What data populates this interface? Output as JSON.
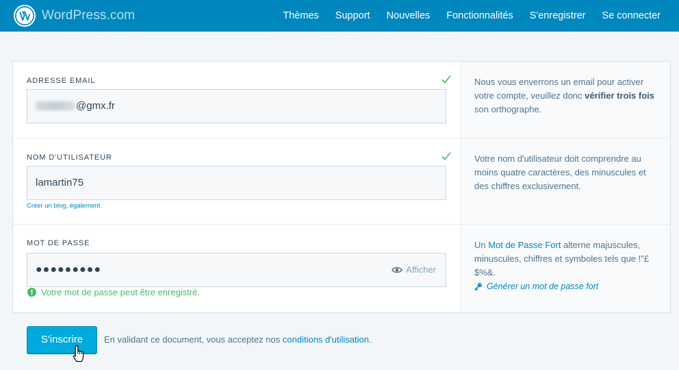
{
  "header": {
    "brand": "WordPress.com",
    "nav": [
      "Thèmes",
      "Support",
      "Nouvelles",
      "Fonctionnalités",
      "S'enregistrer",
      "Se connecter"
    ]
  },
  "email": {
    "label": "ADRESSE EMAIL",
    "value_visible": "@gmx.fr",
    "help_before": "Nous vous enverrons un email pour activer votre compte, veuillez donc ",
    "help_bold": "vérifier trois fois",
    "help_after": " son orthographe."
  },
  "username": {
    "label": "NOM D'UTILISATEUR",
    "value": "lamartin75",
    "blog_link": "Créer un blog, également.",
    "help": "Votre nom d'utilisateur doit comprendre au moins quatre caractères, des minuscules et des chiffres exclusivement."
  },
  "password": {
    "label": "MOT DE PASSE",
    "value_mask": "●●●●●●●●●",
    "show_label": "Afficher",
    "status": "Votre mot de passe peut être enregistré.",
    "help_before": "Un ",
    "help_link": "Mot de Passe Fort",
    "help_after": " alterne majuscules, minuscules, chiffres et symboles tels que !\"£$%&.",
    "generate_link": "Générer un mot de passe fort"
  },
  "footer": {
    "submit": "S'inscrire",
    "terms_before": "En validant ce document, vous acceptez nos ",
    "terms_link": "conditions d'utilisation",
    "terms_after": "."
  },
  "icons": {
    "brand": "wordpress-logo-icon",
    "valid": "checkmark-icon",
    "show": "eye-icon",
    "status": "exclamation-circle-icon",
    "generate": "key-icon",
    "cursor": "hand-pointer-icon"
  },
  "colors": {
    "masthead": "#0087be",
    "accent": "#00aadc",
    "link": "#0087be",
    "success": "#4ab866"
  }
}
